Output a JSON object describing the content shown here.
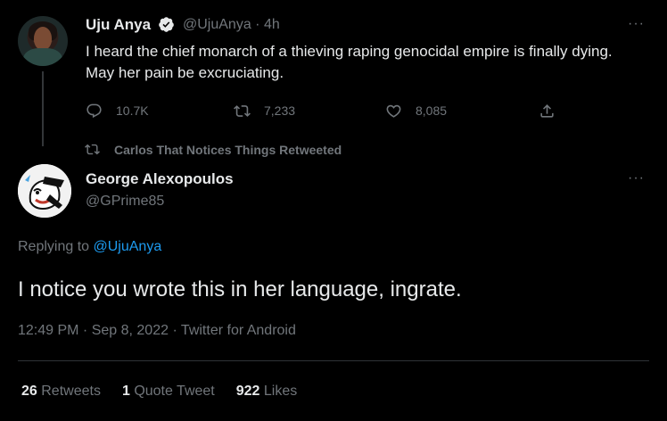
{
  "tweet1": {
    "name": "Uju Anya",
    "handle": "@UjuAnya",
    "separator": "·",
    "time": "4h",
    "text": "I heard the chief monarch of a thieving raping genocidal empire is finally dying. May her pain be excruciating.",
    "replies": "10.7K",
    "retweets": "7,233",
    "likes": "8,085",
    "more": "···"
  },
  "retweet_banner": "Carlos That Notices Things Retweeted",
  "tweet2": {
    "name": "George Alexopoulos",
    "handle": "@GPrime85",
    "more": "···",
    "replying_prefix": "Replying to ",
    "replying_to": "@UjuAnya",
    "text": "I notice you wrote this in her language, ingrate.",
    "meta": "12:49 PM · Sep 8, 2022 · Twitter for Android",
    "stats": [
      {
        "count": "26",
        "label": "Retweets"
      },
      {
        "count": "1",
        "label": "Quote Tweet"
      },
      {
        "count": "922",
        "label": "Likes"
      }
    ]
  },
  "colors": {
    "background": "#000000",
    "text": "#e7e9ea",
    "muted": "#71767b",
    "link": "#1d9bf0",
    "divider": "#2f3336",
    "verified": "#e7e9ea"
  },
  "icons": [
    "reply-icon",
    "retweet-icon",
    "like-icon",
    "share-icon",
    "verified-icon",
    "more-icon"
  ]
}
